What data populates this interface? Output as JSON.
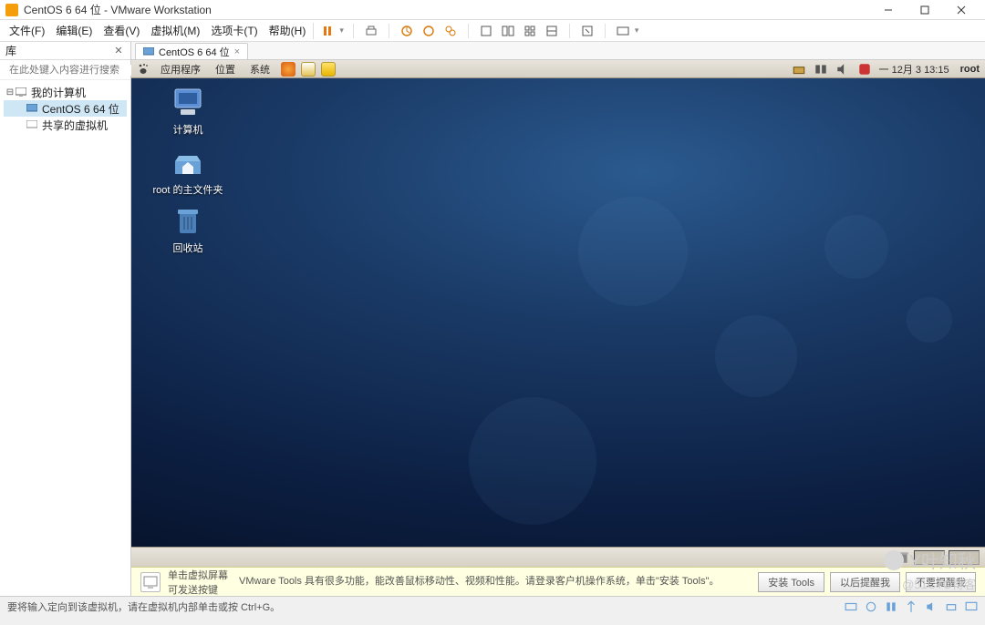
{
  "window": {
    "title": "CentOS 6 64 位 - VMware Workstation"
  },
  "menu": {
    "file": "文件(F)",
    "edit": "编辑(E)",
    "view": "查看(V)",
    "vm": "虚拟机(M)",
    "tabs": "选项卡(T)",
    "help": "帮助(H)"
  },
  "library": {
    "title": "库",
    "search_placeholder": "在此处键入内容进行搜索",
    "root": "我的计算机",
    "items": {
      "centos": "CentOS 6 64 位",
      "shared": "共享的虚拟机"
    }
  },
  "tab": {
    "label": "CentOS 6 64 位"
  },
  "gnome": {
    "applications": "应用程序",
    "places": "位置",
    "system": "系统",
    "clock": "一 12月  3 13:15",
    "user": "root",
    "desktop": {
      "computer": "计算机",
      "home": "root 的主文件夹",
      "trash": "回收站"
    }
  },
  "hint": {
    "line1": "单击虚拟屏幕",
    "line2": "可发送按键",
    "message": "VMware Tools 具有很多功能，能改善鼠标移动性、视频和性能。请登录客户机操作系统，单击\"安装 Tools\"。",
    "install": "安装 Tools",
    "later": "以后提醒我",
    "never": "不要提醒我"
  },
  "status": {
    "text": "要将输入定向到该虚拟机，请在虚拟机内部单击或按 Ctrl+G。"
  },
  "watermark": {
    "line1": "Y叶知秋",
    "line2": "@51CTO博客"
  }
}
